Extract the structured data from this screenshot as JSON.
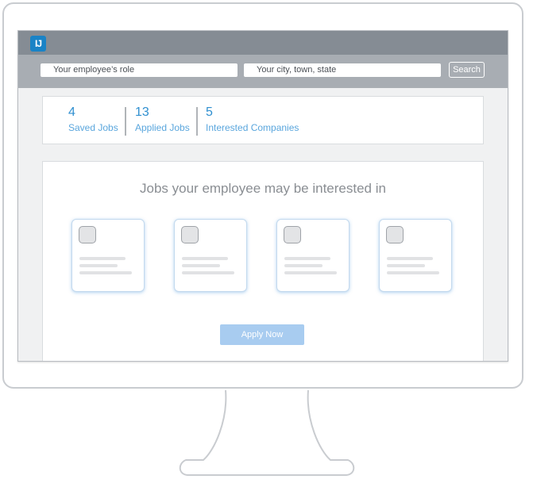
{
  "app": {
    "logo_text": "IJ",
    "logo_icon": "brand-logo-icon",
    "accent": "#1a83c6"
  },
  "search": {
    "role_placeholder": "Your employee’s role",
    "location_placeholder": "Your city, town, state",
    "button_label": "Search"
  },
  "stats": [
    {
      "value": "4",
      "label": "Saved Jobs"
    },
    {
      "value": "13",
      "label": "Applied Jobs"
    },
    {
      "value": "5",
      "label": "Interested Companies"
    }
  ],
  "jobs": {
    "title": "Jobs your employee may be interested in",
    "cards": [
      {
        "thumb_icon": "company-thumb-icon"
      },
      {
        "thumb_icon": "company-thumb-icon"
      },
      {
        "thumb_icon": "company-thumb-icon"
      },
      {
        "thumb_icon": "company-thumb-icon"
      }
    ],
    "apply_label": "Apply Now"
  },
  "colors": {
    "stat_text": "#2f8fd0",
    "header_bar": "#858c94",
    "search_bar": "#a8adb3",
    "apply_button": "#a8ccf0",
    "card_glow": "#6eaae1"
  }
}
